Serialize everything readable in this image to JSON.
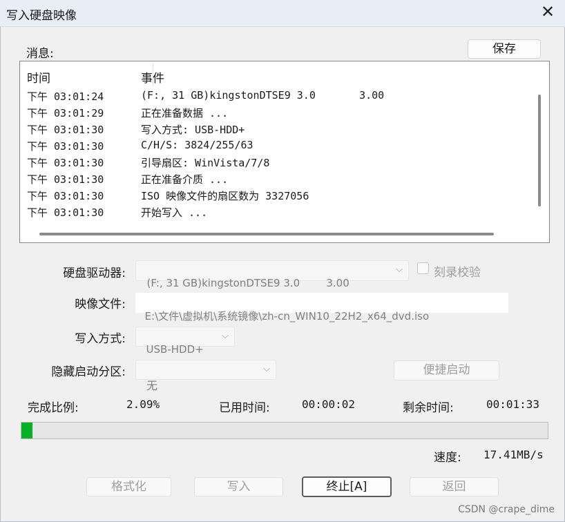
{
  "window": {
    "title": "写入硬盘映像"
  },
  "messages": {
    "label": "消息:",
    "save_label": "保存",
    "columns": [
      "时间",
      "事件"
    ],
    "rows": [
      {
        "time": "下午 03:01:24",
        "event": "(F:, 31 GB)kingstonDTSE9 3.0       3.00"
      },
      {
        "time": "下午 03:01:29",
        "event": "正在准备数据 ..."
      },
      {
        "time": "下午 03:01:30",
        "event": "写入方式: USB-HDD+"
      },
      {
        "time": "下午 03:01:30",
        "event": "C/H/S: 3824/255/63"
      },
      {
        "time": "下午 03:01:30",
        "event": "引导扇区: WinVista/7/8"
      },
      {
        "time": "下午 03:01:30",
        "event": "正在准备介质 ..."
      },
      {
        "time": "下午 03:01:30",
        "event": "ISO 映像文件的扇区数为 3327056"
      },
      {
        "time": "下午 03:01:30",
        "event": "开始写入 ..."
      }
    ]
  },
  "form": {
    "drive_label": "硬盘驱动器:",
    "drive_value": "(F:, 31 GB)kingstonDTSE9 3.0        3.00",
    "verify_label": "刻录校验",
    "image_label": "映像文件:",
    "image_value": "E:\\文件\\虚拟机\\系统镜像\\zh-cn_WIN10_22H2_x64_dvd.iso",
    "method_label": "写入方式:",
    "method_value": "USB-HDD+",
    "hidden_label": "隐藏启动分区:",
    "hidden_value": "无",
    "quickboot_label": "便捷启动"
  },
  "status": {
    "percent_label": "完成比例:",
    "percent_value": "2.09%",
    "elapsed_label": "已用时间:",
    "elapsed_value": "00:00:02",
    "remaining_label": "剩余时间:",
    "remaining_value": "00:01:33",
    "progress_fraction": 0.0209,
    "speed_label": "速度:",
    "speed_value": "17.41MB/s"
  },
  "buttons": {
    "format": "格式化",
    "write": "写入",
    "abort": "终止[A]",
    "back": "返回"
  },
  "watermark": "CSDN @crape_dime",
  "colors": {
    "progress": "#06b025",
    "titlebar": "#e9eef6"
  }
}
